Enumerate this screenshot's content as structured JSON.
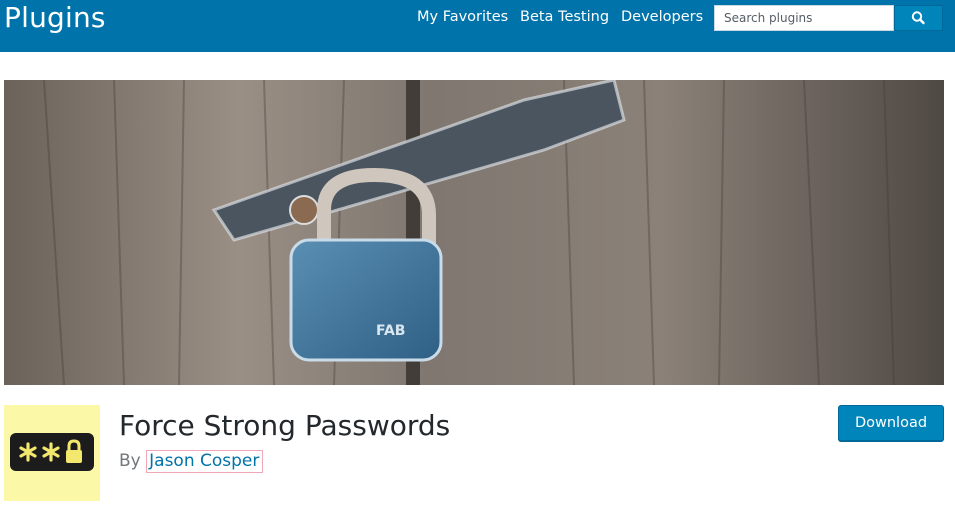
{
  "header": {
    "site_title": "Plugins",
    "nav": [
      "My Favorites",
      "Beta Testing",
      "Developers"
    ],
    "search_placeholder": "Search plugins",
    "search_icon": "search-icon",
    "bg_color": "#0073aa"
  },
  "plugin": {
    "title": "Force Strong Passwords",
    "by_prefix": "By",
    "author": "Jason Cosper",
    "icon": "password-asterisks-lock-icon",
    "download_label": "Download"
  },
  "colors": {
    "accent": "#0085ba",
    "icon_bg": "#fbf8a7"
  }
}
